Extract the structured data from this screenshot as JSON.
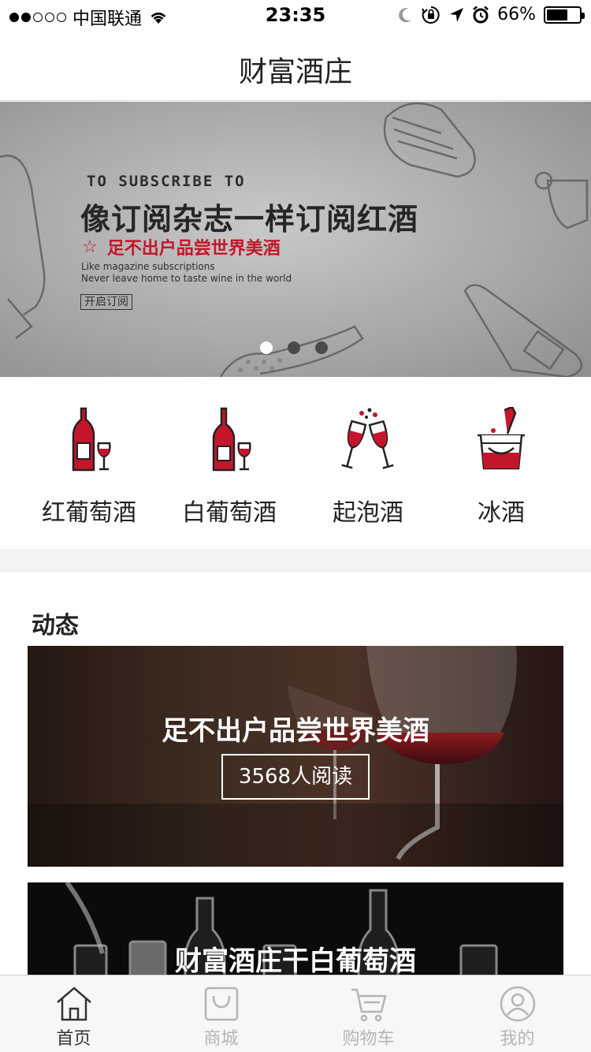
{
  "status_bar": {
    "carrier": "中国联通",
    "time": "23:35",
    "battery_percent": "66%",
    "battery_level": 0.66,
    "signal_bars_filled": 2,
    "signal_bars_total": 5,
    "icons": [
      "wifi-icon",
      "moon-icon",
      "orientation-lock-icon",
      "location-icon",
      "alarm-icon",
      "battery-icon"
    ]
  },
  "nav": {
    "title": "财富酒庄"
  },
  "banner": {
    "en_heading": "TO SUBSCRIBE TO",
    "title": "像订阅杂志一样订阅红酒",
    "star": "☆",
    "subtitle": "足不出户品尝世界美酒",
    "en_line1": "Like magazine subscriptions",
    "en_line2": "Never leave home to taste wine in the world",
    "button": "开启订阅",
    "pages": 3,
    "active_page": 1
  },
  "categories": [
    {
      "label": "红葡萄酒",
      "icon": "red-wine-bottle-icon"
    },
    {
      "label": "白葡萄酒",
      "icon": "white-wine-bottle-icon"
    },
    {
      "label": "起泡酒",
      "icon": "sparkling-toast-icon"
    },
    {
      "label": "冰酒",
      "icon": "ice-bucket-icon"
    }
  ],
  "feed": {
    "section_title": "动态",
    "cards": [
      {
        "title": "足不出户品尝世界美酒",
        "reads": "3568人阅读"
      },
      {
        "title": "财富酒庄干白葡萄酒"
      }
    ]
  },
  "tab_bar": {
    "tabs": [
      {
        "label": "首页",
        "icon": "home-icon",
        "active": true
      },
      {
        "label": "商城",
        "icon": "shopping-bag-icon",
        "active": false
      },
      {
        "label": "购物车",
        "icon": "cart-icon",
        "active": false
      },
      {
        "label": "我的",
        "icon": "profile-icon",
        "active": false
      }
    ]
  },
  "colors": {
    "accent": "#c4162a",
    "tab_inactive": "#b5b5b5",
    "tab_active": "#333333"
  }
}
